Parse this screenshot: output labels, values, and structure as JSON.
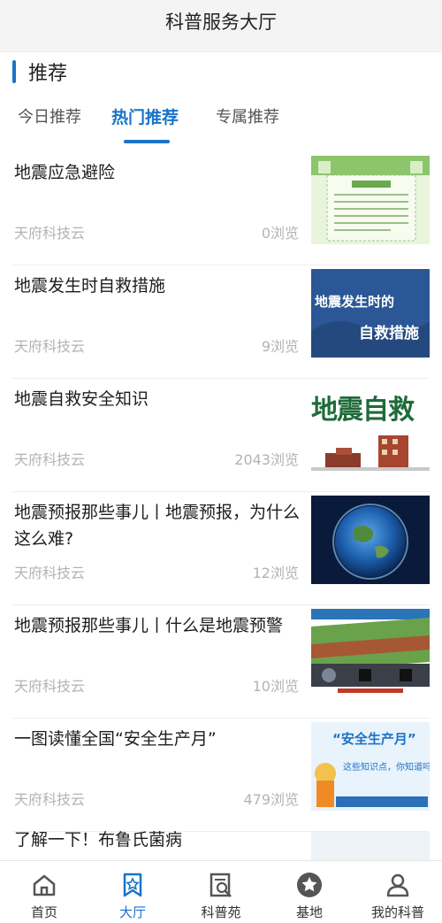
{
  "header": {
    "title": "科普服务大厅"
  },
  "section": {
    "title": "推荐"
  },
  "tabs": [
    {
      "label": "今日推荐"
    },
    {
      "label": "热门推荐"
    },
    {
      "label": "专属推荐"
    }
  ],
  "articles": [
    {
      "title": "地震应急避险",
      "source": "天府科技云",
      "views": "0浏览"
    },
    {
      "title": "地震发生时自救措施",
      "source": "天府科技云",
      "views": "9浏览",
      "thumb_text": [
        "地震发生时的",
        "自救措施"
      ]
    },
    {
      "title": "地震自救安全知识",
      "source": "天府科技云",
      "views": "2043浏览",
      "thumb_text": "地震自救"
    },
    {
      "title": "地震预报那些事儿丨地震预报，为什么这么难?",
      "source": "天府科技云",
      "views": "12浏览"
    },
    {
      "title": "地震预报那些事儿丨什么是地震预警",
      "source": "天府科技云",
      "views": "10浏览"
    },
    {
      "title": "一图读懂全国“安全生产月”",
      "source": "天府科技云",
      "views": "479浏览",
      "thumb_text": [
        "“安全生产月”",
        "这些知识点，你知道吗？"
      ]
    }
  ],
  "partial_article": {
    "title": "了解一下！布鲁氏菌病"
  },
  "bottom_nav": [
    {
      "label": "首页",
      "icon": "home-icon"
    },
    {
      "label": "大厅",
      "icon": "hall-icon"
    },
    {
      "label": "科普苑",
      "icon": "science-garden-icon"
    },
    {
      "label": "基地",
      "icon": "star-base-icon"
    },
    {
      "label": "我的科普",
      "icon": "user-icon"
    }
  ],
  "colors": {
    "accent": "#1a73c8",
    "muted": "#b3b3b3"
  }
}
